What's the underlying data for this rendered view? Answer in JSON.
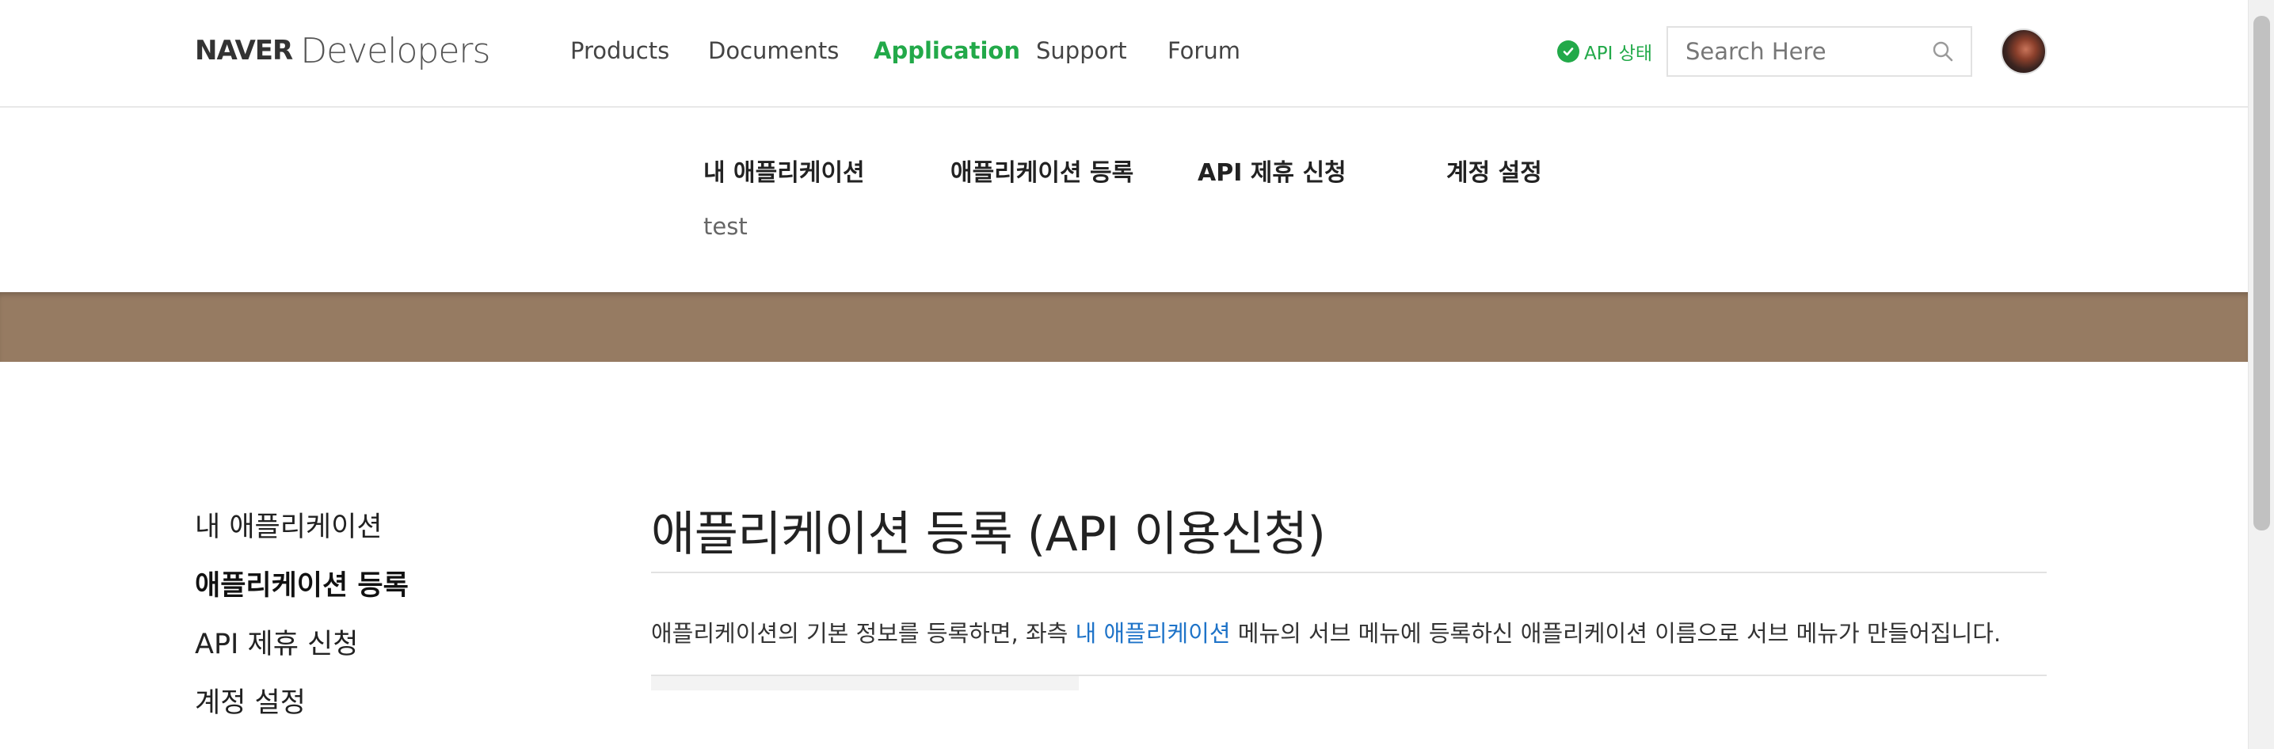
{
  "logo": {
    "brand": "NAVER",
    "product": "Developers"
  },
  "gnb": [
    {
      "label": "Products",
      "active": false
    },
    {
      "label": "Documents",
      "active": false
    },
    {
      "label": "Application",
      "active": true
    },
    {
      "label": "Support",
      "active": false
    },
    {
      "label": "Forum",
      "active": false
    }
  ],
  "api_status": {
    "label": "API 상태",
    "color": "#22a949"
  },
  "search": {
    "placeholder": "Search Here",
    "icon": "search-icon"
  },
  "submenu": {
    "items": [
      "내 애플리케이션",
      "애플리케이션 등록",
      "API 제휴 신청",
      "계정 설정"
    ],
    "sub_items": [
      "test"
    ]
  },
  "band_color": "#967b62",
  "sidebar": {
    "items": [
      {
        "label": "내 애플리케이션",
        "active": false
      },
      {
        "label": "애플리케이션 등록",
        "active": true
      },
      {
        "label": "API 제휴 신청",
        "active": false
      },
      {
        "label": "계정 설정",
        "active": false
      }
    ]
  },
  "main": {
    "title": "애플리케이션 등록 (API 이용신청)",
    "desc_before": "애플리케이션의 기본 정보를 등록하면, 좌측 ",
    "desc_link": "내 애플리케이션",
    "desc_after": " 메뉴의 서브 메뉴에 등록하신 애플리케이션 이름으로 서브 메뉴가 만들어집니다."
  },
  "colors": {
    "accent": "#22a949",
    "link": "#1e73c8"
  }
}
